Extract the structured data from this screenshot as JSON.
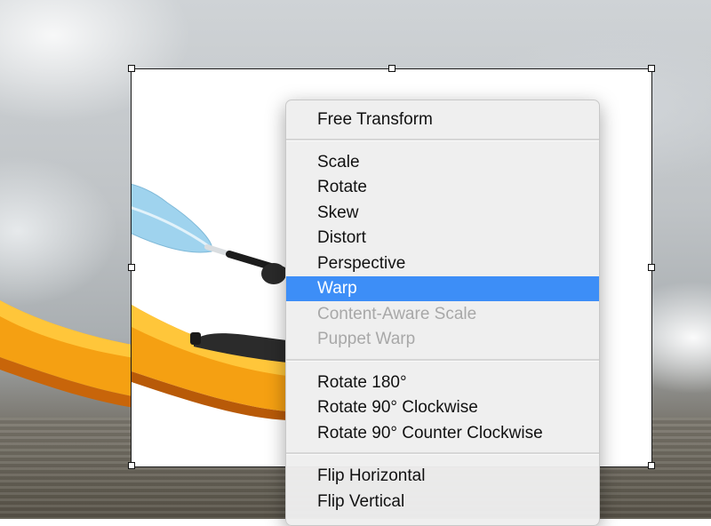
{
  "menu": {
    "items": [
      {
        "label": "Free Transform",
        "enabled": true,
        "highlighted": false
      },
      {
        "label": "Scale",
        "enabled": true,
        "highlighted": false
      },
      {
        "label": "Rotate",
        "enabled": true,
        "highlighted": false
      },
      {
        "label": "Skew",
        "enabled": true,
        "highlighted": false
      },
      {
        "label": "Distort",
        "enabled": true,
        "highlighted": false
      },
      {
        "label": "Perspective",
        "enabled": true,
        "highlighted": false
      },
      {
        "label": "Warp",
        "enabled": true,
        "highlighted": true
      },
      {
        "label": "Content-Aware Scale",
        "enabled": false,
        "highlighted": false
      },
      {
        "label": "Puppet Warp",
        "enabled": false,
        "highlighted": false
      },
      {
        "label": "Rotate 180°",
        "enabled": true,
        "highlighted": false
      },
      {
        "label": "Rotate 90° Clockwise",
        "enabled": true,
        "highlighted": false
      },
      {
        "label": "Rotate 90° Counter Clockwise",
        "enabled": true,
        "highlighted": false
      },
      {
        "label": "Flip Horizontal",
        "enabled": true,
        "highlighted": false
      },
      {
        "label": "Flip Vertical",
        "enabled": true,
        "highlighted": false
      }
    ]
  },
  "colors": {
    "highlight": "#3d8ef7",
    "kayak": "#f5a012",
    "paddle_blade": "#9fd3ee"
  }
}
